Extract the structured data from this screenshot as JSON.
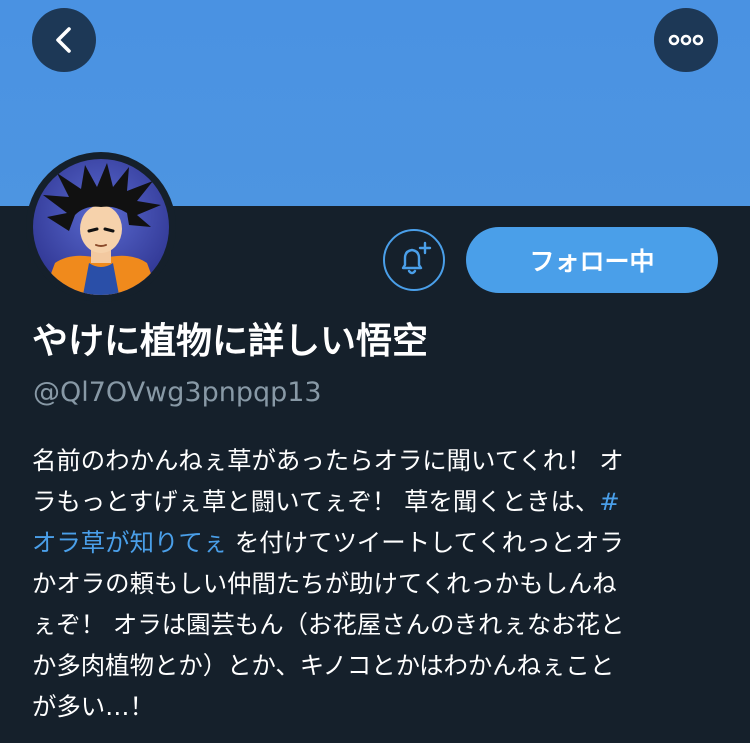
{
  "colors": {
    "banner": "#4a92e2",
    "background": "#15202b",
    "accent": "#4a9fe9",
    "muted": "#8899a6"
  },
  "header": {
    "back_icon": "chevron-left-icon",
    "more_icon": "more-horizontal-icon"
  },
  "profile": {
    "display_name": "やけに植物に詳しい悟空",
    "handle": "@Ql7OVwg3pnpqp13",
    "follow_label": "フォロー中",
    "notify_icon": "bell-plus-icon",
    "bio": {
      "line1": "名前のわかんねぇ草があったらオラに聞いてくれ！ オ",
      "line2": "ラもっとすげぇ草と闘いてぇぞ！ 草を聞くときは、#",
      "hashtag_cont": "オラ草が知りてぇ",
      "line3_rest": " を付けてツイートしてくれっとオラ",
      "line4": "かオラの頼もしい仲間たちが助けてくれっかもしんね",
      "line5": "ぇぞ！ オラは園芸もん（お花屋さんのきれぇなお花と",
      "line6": "か多肉植物とか）とか、キノコとかはわかんねぇこと",
      "line7": "が多い…！"
    }
  }
}
